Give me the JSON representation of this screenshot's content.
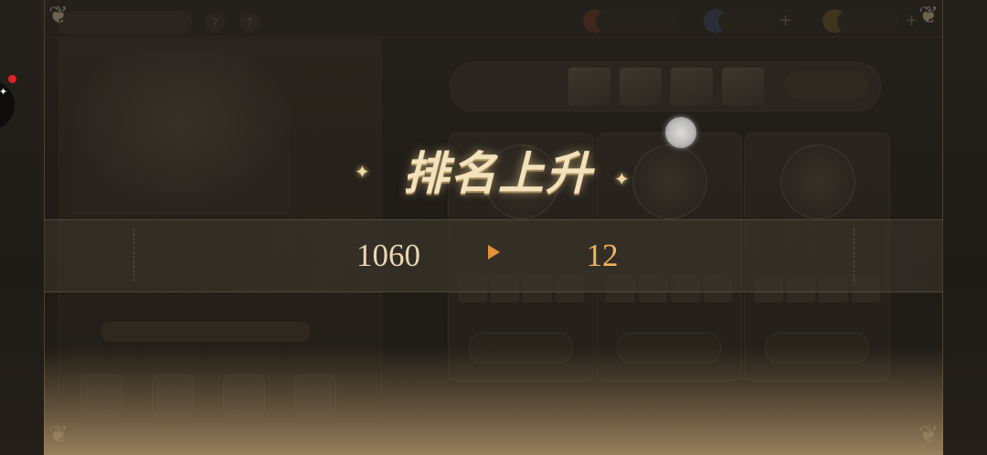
{
  "overlay": {
    "title": "排名上升",
    "old_rank": "1060",
    "new_rank": "12",
    "colors": {
      "title": "#f3e2bb",
      "old_rank": "#e8d7b3",
      "new_rank": "#f0b45a",
      "arrow": "#e19235"
    },
    "icons": {
      "arrow": "triangle-right-icon",
      "sparkle": "four-point-star-icon"
    }
  },
  "notification": {
    "has_red_dot": true,
    "red_dot_color": "#e0202a"
  }
}
